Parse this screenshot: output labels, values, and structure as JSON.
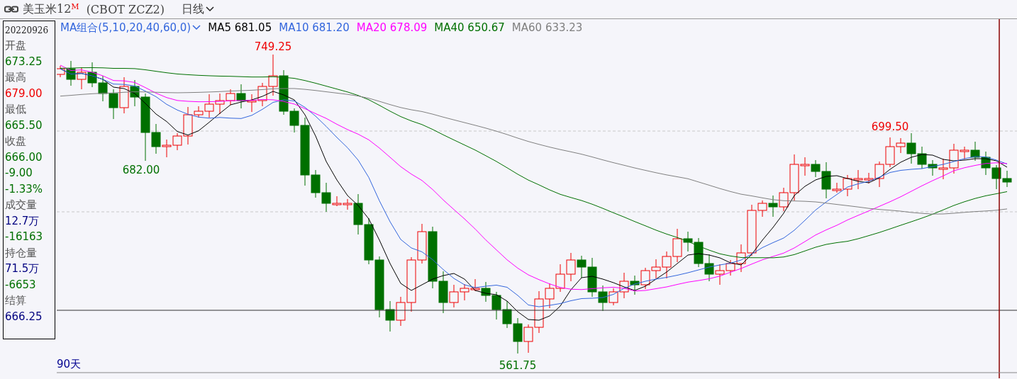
{
  "header": {
    "name": "美玉米12",
    "superscript": "M",
    "code": "(CBOT  ZCZ2)",
    "period": "日线"
  },
  "info_panel": {
    "date": "20220926",
    "items": [
      {
        "text": "开盘",
        "color": "#555555"
      },
      {
        "text": "673.25",
        "color": "#007000"
      },
      {
        "text": "最高",
        "color": "#555555"
      },
      {
        "text": "679.00",
        "color": "#ee0000"
      },
      {
        "text": "最低",
        "color": "#555555"
      },
      {
        "text": "665.50",
        "color": "#007000"
      },
      {
        "text": "收盘",
        "color": "#555555"
      },
      {
        "text": "666.00",
        "color": "#007000"
      },
      {
        "text": "-9.00",
        "color": "#007000"
      },
      {
        "text": "-1.33%",
        "color": "#007000"
      },
      {
        "text": "成交量",
        "color": "#555555"
      },
      {
        "text": "12.7万",
        "color": "#000080"
      },
      {
        "text": "-16163",
        "color": "#007000"
      },
      {
        "text": "持仓量",
        "color": "#555555"
      },
      {
        "text": "71.5万",
        "color": "#000080"
      },
      {
        "text": "-6653",
        "color": "#007000"
      },
      {
        "text": "结算",
        "color": "#555555"
      },
      {
        "text": "666.25",
        "color": "#000080"
      }
    ]
  },
  "indicator": {
    "name": "MA组合(5,10,20,40,60,0)",
    "legend": [
      {
        "text": "MA5 681.05",
        "color": "#000000"
      },
      {
        "text": "MA10 681.20",
        "color": "#3366dd"
      },
      {
        "text": "MA20 678.09",
        "color": "#ff00ff"
      },
      {
        "text": "MA40 650.67",
        "color": "#007000"
      },
      {
        "text": "MA60 633.23",
        "color": "#808080"
      }
    ]
  },
  "chart": {
    "price_labels": [
      {
        "text": "749.25",
        "kind": "high"
      },
      {
        "text": "682.00",
        "kind": "low"
      },
      {
        "text": "699.50",
        "kind": "high"
      },
      {
        "text": "561.75",
        "kind": "low"
      }
    ],
    "range": "90天"
  }
}
